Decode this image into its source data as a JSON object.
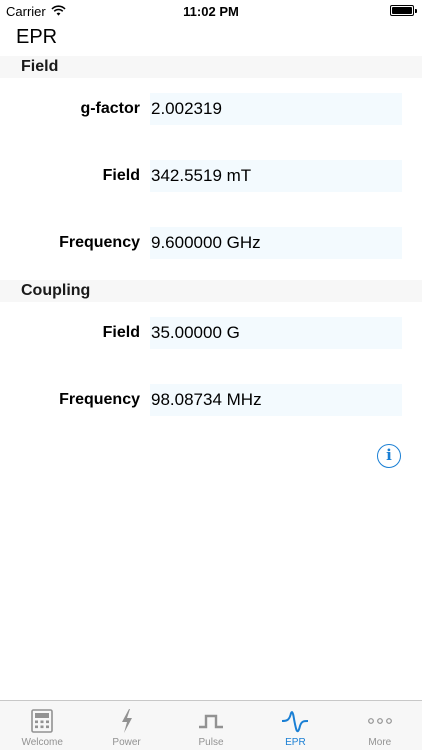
{
  "status_bar": {
    "carrier": "Carrier",
    "time": "11:02 PM"
  },
  "header": {
    "title": "EPR"
  },
  "sections": {
    "field": {
      "title": "Field",
      "rows": [
        {
          "label": "g-factor",
          "value": "2.002319"
        },
        {
          "label": "Field",
          "value": "342.5519 mT"
        },
        {
          "label": "Frequency",
          "value": "9.600000 GHz"
        }
      ]
    },
    "coupling": {
      "title": "Coupling",
      "rows": [
        {
          "label": "Field",
          "value": "35.00000 G"
        },
        {
          "label": "Frequency",
          "value": "98.08734 MHz"
        }
      ]
    }
  },
  "info_button": {
    "glyph": "i"
  },
  "colors": {
    "accent": "#1a7fd4",
    "field_bg": "#f3fafe",
    "section_bg": "#f7f7f7",
    "tab_inactive": "#929292"
  },
  "tab_bar": {
    "items": [
      {
        "label": "Welcome",
        "icon": "calculator-icon",
        "active": false
      },
      {
        "label": "Power",
        "icon": "lightning-icon",
        "active": false
      },
      {
        "label": "Pulse",
        "icon": "pulse-icon",
        "active": false
      },
      {
        "label": "EPR",
        "icon": "epr-signal-icon",
        "active": true
      },
      {
        "label": "More",
        "icon": "more-dots-icon",
        "active": false
      }
    ]
  }
}
